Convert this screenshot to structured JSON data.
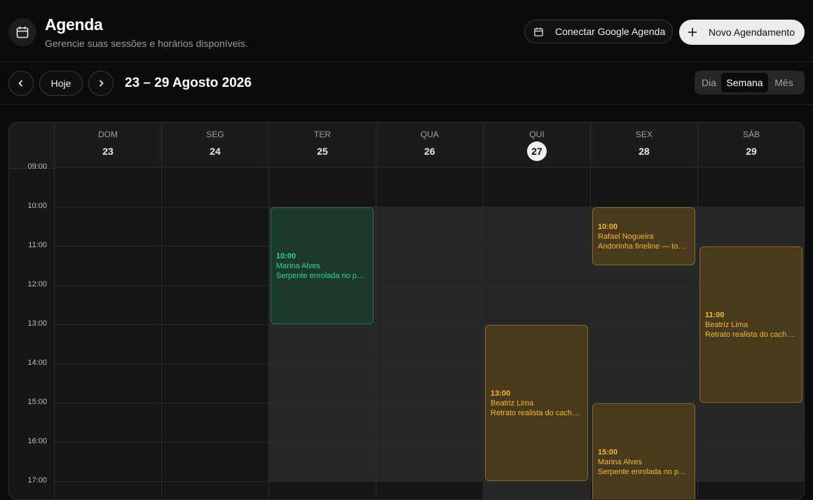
{
  "header": {
    "title": "Agenda",
    "subtitle": "Gerencie suas sessões e horários disponíveis.",
    "google_label": "Conectar Google Agenda",
    "new_label": "Novo Agendamento"
  },
  "toolbar": {
    "today_label": "Hoje",
    "range": "23 – 29 Agosto 2026",
    "views": [
      {
        "label": "Dia",
        "active": false
      },
      {
        "label": "Semana",
        "active": true
      },
      {
        "label": "Mês",
        "active": false
      }
    ]
  },
  "calendar": {
    "days": [
      {
        "dow": "DOM",
        "num": "23"
      },
      {
        "dow": "SEG",
        "num": "24"
      },
      {
        "dow": "TER",
        "num": "25"
      },
      {
        "dow": "QUA",
        "num": "26"
      },
      {
        "dow": "QUI",
        "num": "27",
        "today": true
      },
      {
        "dow": "SEX",
        "num": "28"
      },
      {
        "dow": "SÁB",
        "num": "29"
      }
    ],
    "hours": [
      "09:00",
      "10:00",
      "11:00",
      "12:00",
      "13:00",
      "14:00",
      "15:00",
      "16:00",
      "17:00"
    ],
    "first_hour": 9,
    "available_hours": [
      10,
      17
    ],
    "events": [
      {
        "day": 2,
        "start": 10,
        "end": 13,
        "time": "10:00",
        "client": "Marina Alves",
        "desc": "Serpente enrolada no pun...",
        "status": "green"
      },
      {
        "day": 5,
        "start": 10,
        "end": 11.5,
        "time": "10:00",
        "client": "Rafael Nogueira",
        "desc": "Andorinha fineline — tom...",
        "status": "amber"
      },
      {
        "day": 6,
        "start": 11,
        "end": 15,
        "time": "11:00",
        "client": "Beatriz Lima",
        "desc": "Retrato realista do cachorr...",
        "status": "amber"
      },
      {
        "day": 4,
        "start": 13,
        "end": 17,
        "time": "13:00",
        "client": "Beatriz Lima",
        "desc": "Retrato realista do cachorr...",
        "status": "amber"
      },
      {
        "day": 5,
        "start": 15,
        "end": 18,
        "time": "15:00",
        "client": "Marina Alves",
        "desc": "Serpente enrolada no pun...",
        "status": "amber"
      }
    ]
  },
  "colors": {
    "accent_green": "#3ed38a",
    "accent_amber": "#f2b838"
  }
}
